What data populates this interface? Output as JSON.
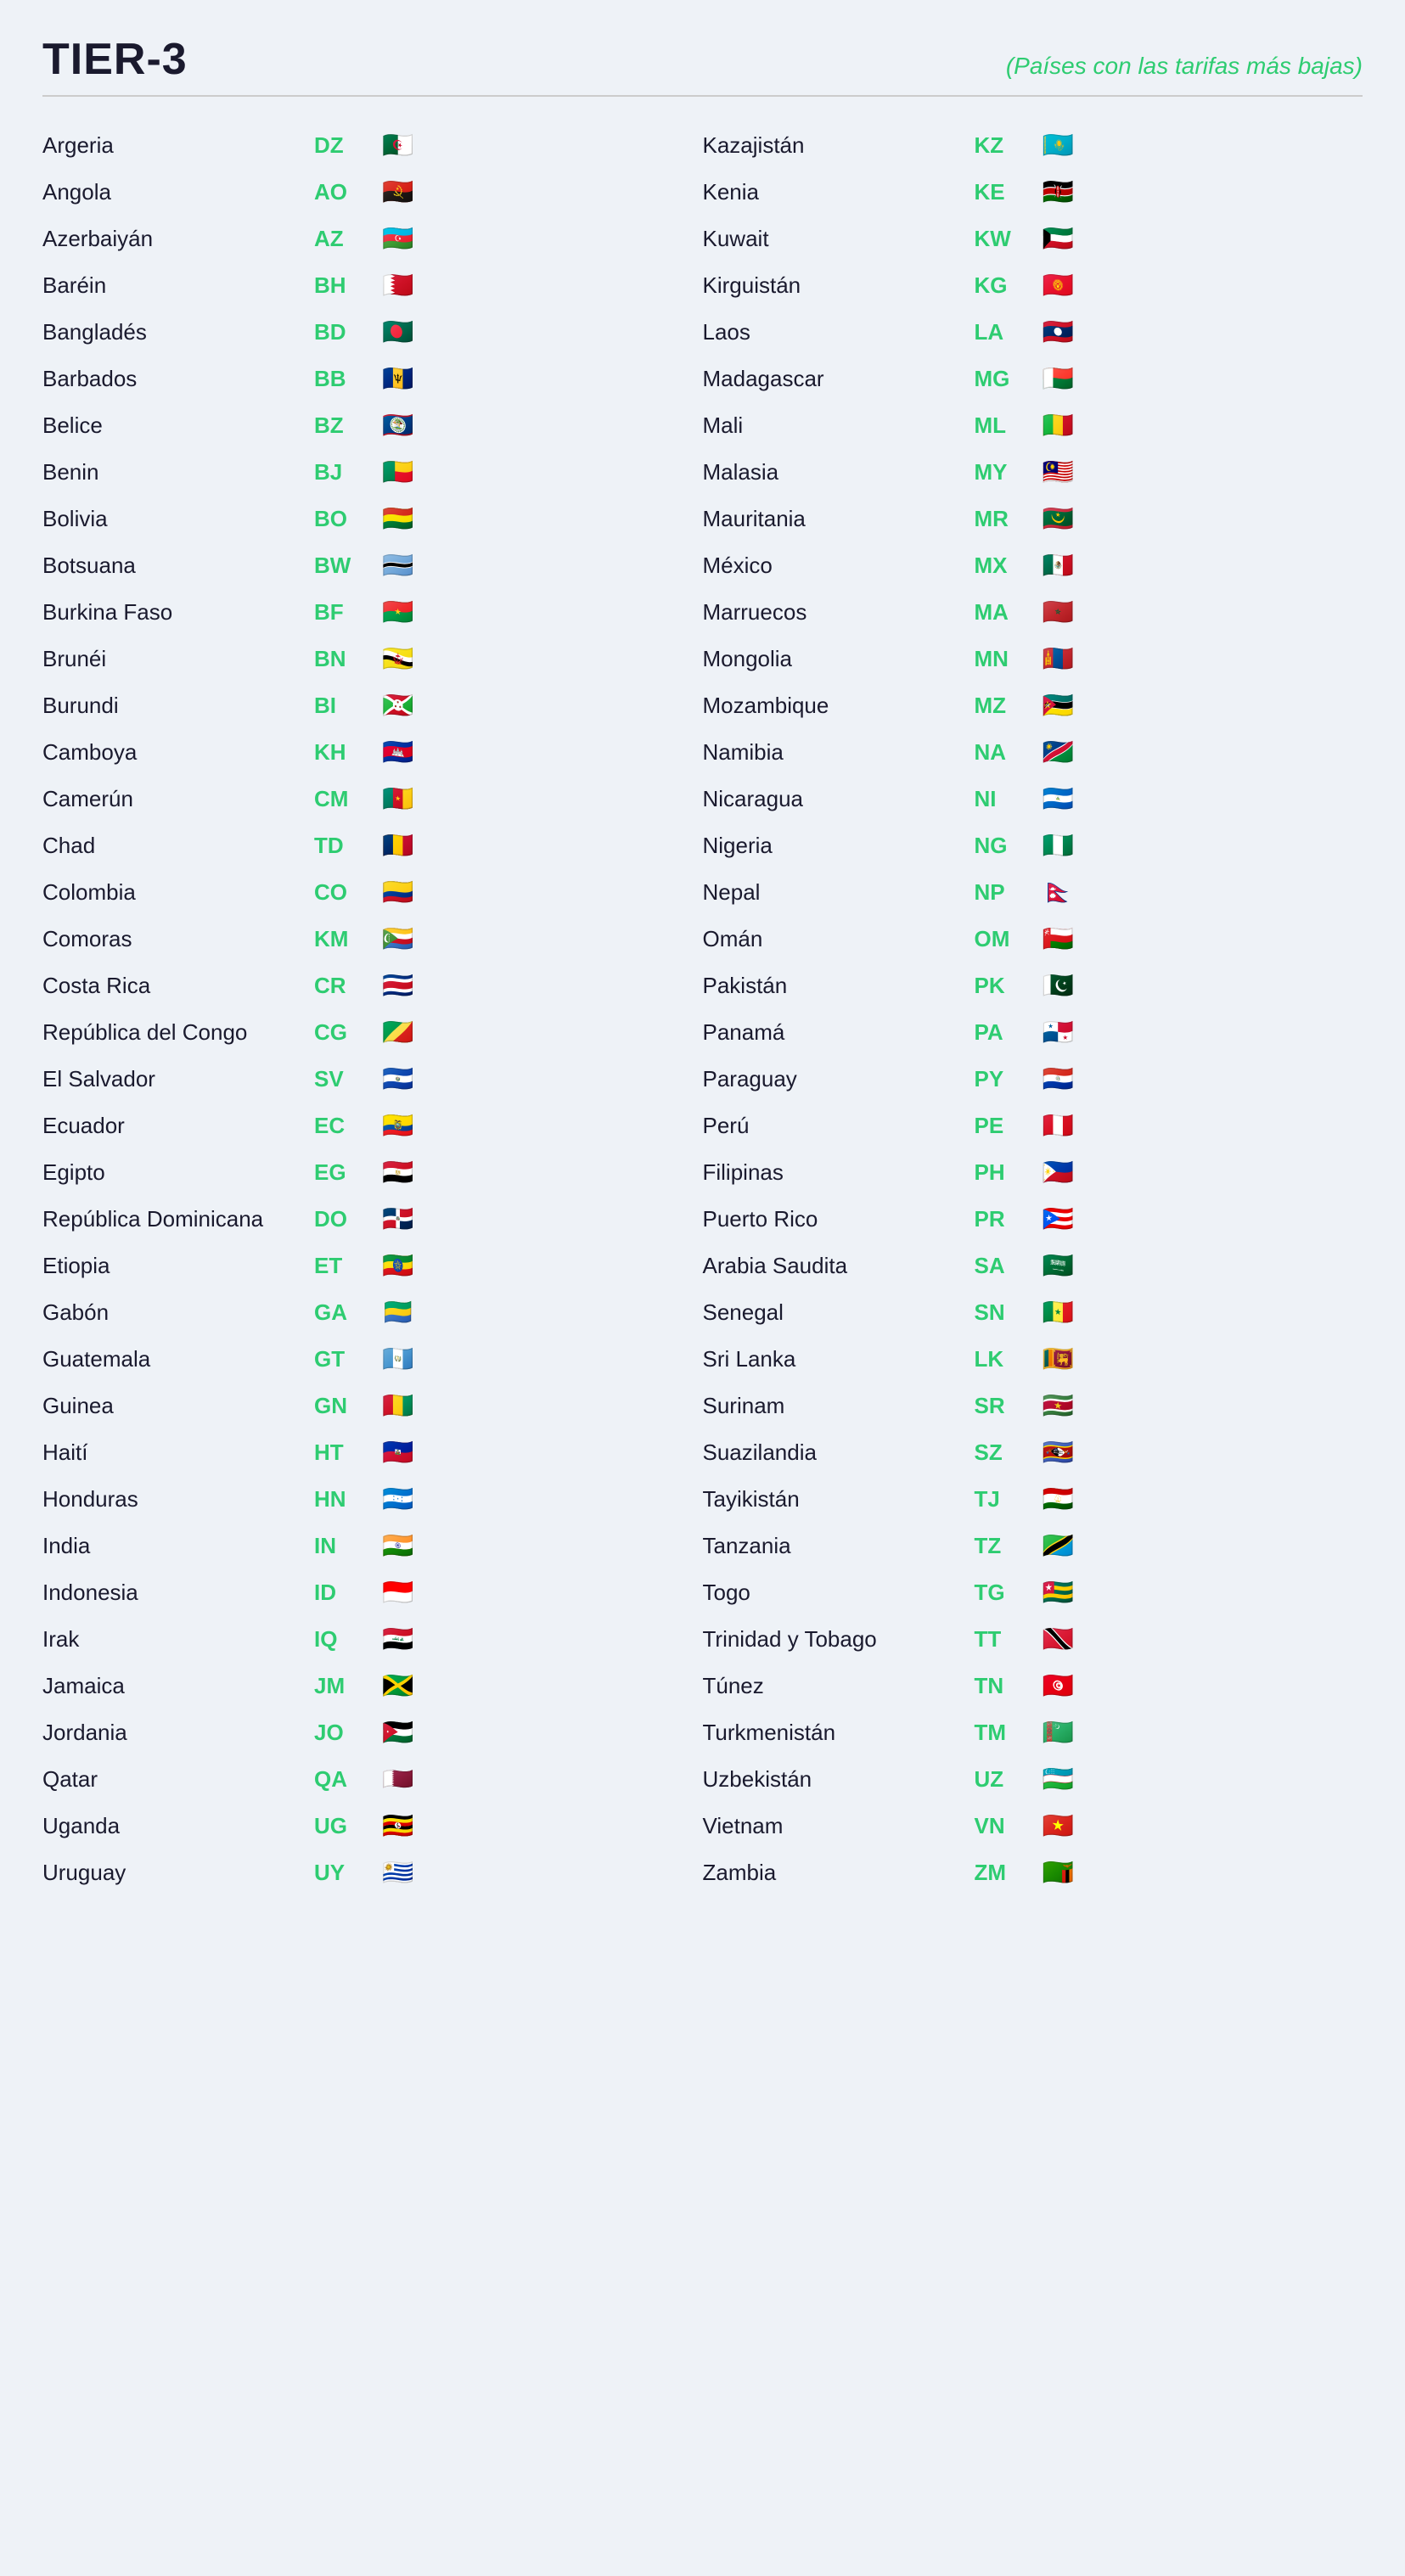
{
  "header": {
    "title": "TIER-3",
    "subtitle": "(Países con las tarifas más bajas)"
  },
  "left_column": [
    {
      "name": "Argeria",
      "code": "DZ",
      "flag": "🇩🇿"
    },
    {
      "name": "Angola",
      "code": "AO",
      "flag": "🇦🇴"
    },
    {
      "name": "Azerbaiyán",
      "code": "AZ",
      "flag": "🇦🇿"
    },
    {
      "name": "Baréin",
      "code": "BH",
      "flag": "🇧🇭"
    },
    {
      "name": "Bangladés",
      "code": "BD",
      "flag": "🇧🇩"
    },
    {
      "name": "Barbados",
      "code": "BB",
      "flag": "🇧🇧"
    },
    {
      "name": "Belice",
      "code": "BZ",
      "flag": "🇧🇿"
    },
    {
      "name": "Benin",
      "code": "BJ",
      "flag": "🇧🇯"
    },
    {
      "name": "Bolivia",
      "code": "BO",
      "flag": "🇧🇴"
    },
    {
      "name": "Botsuana",
      "code": "BW",
      "flag": "🇧🇼"
    },
    {
      "name": "Burkina Faso",
      "code": "BF",
      "flag": "🇧🇫"
    },
    {
      "name": "Brunéi",
      "code": "BN",
      "flag": "🇧🇳"
    },
    {
      "name": "Burundi",
      "code": "BI",
      "flag": "🇧🇮"
    },
    {
      "name": "Camboya",
      "code": "KH",
      "flag": "🇰🇭"
    },
    {
      "name": "Camerún",
      "code": "CM",
      "flag": "🇨🇲"
    },
    {
      "name": "Chad",
      "code": "TD",
      "flag": "🇹🇩"
    },
    {
      "name": "Colombia",
      "code": "CO",
      "flag": "🇨🇴"
    },
    {
      "name": "Comoras",
      "code": "KM",
      "flag": "🇰🇲"
    },
    {
      "name": "Costa Rica",
      "code": "CR",
      "flag": "🇨🇷"
    },
    {
      "name": "República del Congo",
      "code": "CG",
      "flag": "🇨🇬"
    },
    {
      "name": "El Salvador",
      "code": "SV",
      "flag": "🇸🇻"
    },
    {
      "name": "Ecuador",
      "code": "EC",
      "flag": "🇪🇨"
    },
    {
      "name": "Egipto",
      "code": "EG",
      "flag": "🇪🇬"
    },
    {
      "name": "República Dominicana",
      "code": "DO",
      "flag": "🇩🇴"
    },
    {
      "name": "Etiopia",
      "code": "ET",
      "flag": "🇪🇹"
    },
    {
      "name": "Gabón",
      "code": "GA",
      "flag": "🇬🇦"
    },
    {
      "name": "Guatemala",
      "code": "GT",
      "flag": "🇬🇹"
    },
    {
      "name": "Guinea",
      "code": "GN",
      "flag": "🇬🇳"
    },
    {
      "name": "Haití",
      "code": "HT",
      "flag": "🇭🇹"
    },
    {
      "name": "Honduras",
      "code": "HN",
      "flag": "🇭🇳"
    },
    {
      "name": "India",
      "code": "IN",
      "flag": "🇮🇳"
    },
    {
      "name": "Indonesia",
      "code": "ID",
      "flag": "🇮🇩"
    },
    {
      "name": "Irak",
      "code": "IQ",
      "flag": "🇮🇶"
    },
    {
      "name": "Jamaica",
      "code": "JM",
      "flag": "🇯🇲"
    },
    {
      "name": "Jordania",
      "code": "JO",
      "flag": "🇯🇴"
    },
    {
      "name": "Qatar",
      "code": "QA",
      "flag": "🇶🇦"
    },
    {
      "name": "Uganda",
      "code": "UG",
      "flag": "🇺🇬"
    },
    {
      "name": "Uruguay",
      "code": "UY",
      "flag": "🇺🇾"
    }
  ],
  "right_column": [
    {
      "name": "Kazajistán",
      "code": "KZ",
      "flag": "🇰🇿"
    },
    {
      "name": "Kenia",
      "code": "KE",
      "flag": "🇰🇪"
    },
    {
      "name": "Kuwait",
      "code": "KW",
      "flag": "🇰🇼"
    },
    {
      "name": "Kirguistán",
      "code": "KG",
      "flag": "🇰🇬"
    },
    {
      "name": "Laos",
      "code": "LA",
      "flag": "🇱🇦"
    },
    {
      "name": "Madagascar",
      "code": "MG",
      "flag": "🇲🇬"
    },
    {
      "name": "Mali",
      "code": "ML",
      "flag": "🇲🇱"
    },
    {
      "name": "Malasia",
      "code": "MY",
      "flag": "🇲🇾"
    },
    {
      "name": "Mauritania",
      "code": "MR",
      "flag": "🇲🇷"
    },
    {
      "name": "México",
      "code": "MX",
      "flag": "🇲🇽"
    },
    {
      "name": "Marruecos",
      "code": "MA",
      "flag": "🇲🇦"
    },
    {
      "name": "Mongolia",
      "code": "MN",
      "flag": "🇲🇳"
    },
    {
      "name": "Mozambique",
      "code": "MZ",
      "flag": "🇲🇿"
    },
    {
      "name": "Namibia",
      "code": "NA",
      "flag": "🇳🇦"
    },
    {
      "name": "Nicaragua",
      "code": "NI",
      "flag": "🇳🇮"
    },
    {
      "name": "Nigeria",
      "code": "NG",
      "flag": "🇳🇬"
    },
    {
      "name": "Nepal",
      "code": "NP",
      "flag": "🇳🇵"
    },
    {
      "name": "Omán",
      "code": "OM",
      "flag": "🇴🇲"
    },
    {
      "name": "Pakistán",
      "code": "PK",
      "flag": "🇵🇰"
    },
    {
      "name": "Panamá",
      "code": "PA",
      "flag": "🇵🇦"
    },
    {
      "name": "Paraguay",
      "code": "PY",
      "flag": "🇵🇾"
    },
    {
      "name": "Perú",
      "code": "PE",
      "flag": "🇵🇪"
    },
    {
      "name": "Filipinas",
      "code": "PH",
      "flag": "🇵🇭"
    },
    {
      "name": "Puerto Rico",
      "code": "PR",
      "flag": "🇵🇷"
    },
    {
      "name": "Arabia Saudita",
      "code": "SA",
      "flag": "🇸🇦"
    },
    {
      "name": "Senegal",
      "code": "SN",
      "flag": "🇸🇳"
    },
    {
      "name": "Sri Lanka",
      "code": "LK",
      "flag": "🇱🇰"
    },
    {
      "name": "Surinam",
      "code": "SR",
      "flag": "🇸🇷"
    },
    {
      "name": "Suazilandia",
      "code": "SZ",
      "flag": "🇸🇿"
    },
    {
      "name": "Tayikistán",
      "code": "TJ",
      "flag": "🇹🇯"
    },
    {
      "name": "Tanzania",
      "code": "TZ",
      "flag": "🇹🇿"
    },
    {
      "name": "Togo",
      "code": "TG",
      "flag": "🇹🇬"
    },
    {
      "name": "Trinidad y Tobago",
      "code": "TT",
      "flag": "🇹🇹"
    },
    {
      "name": "Túnez",
      "code": "TN",
      "flag": "🇹🇳"
    },
    {
      "name": "Turkmenistán",
      "code": "TM",
      "flag": "🇹🇲"
    },
    {
      "name": "Uzbekistán",
      "code": "UZ",
      "flag": "🇺🇿"
    },
    {
      "name": "Vietnam",
      "code": "VN",
      "flag": "🇻🇳"
    },
    {
      "name": "Zambia",
      "code": "ZM",
      "flag": "🇿🇲"
    }
  ]
}
